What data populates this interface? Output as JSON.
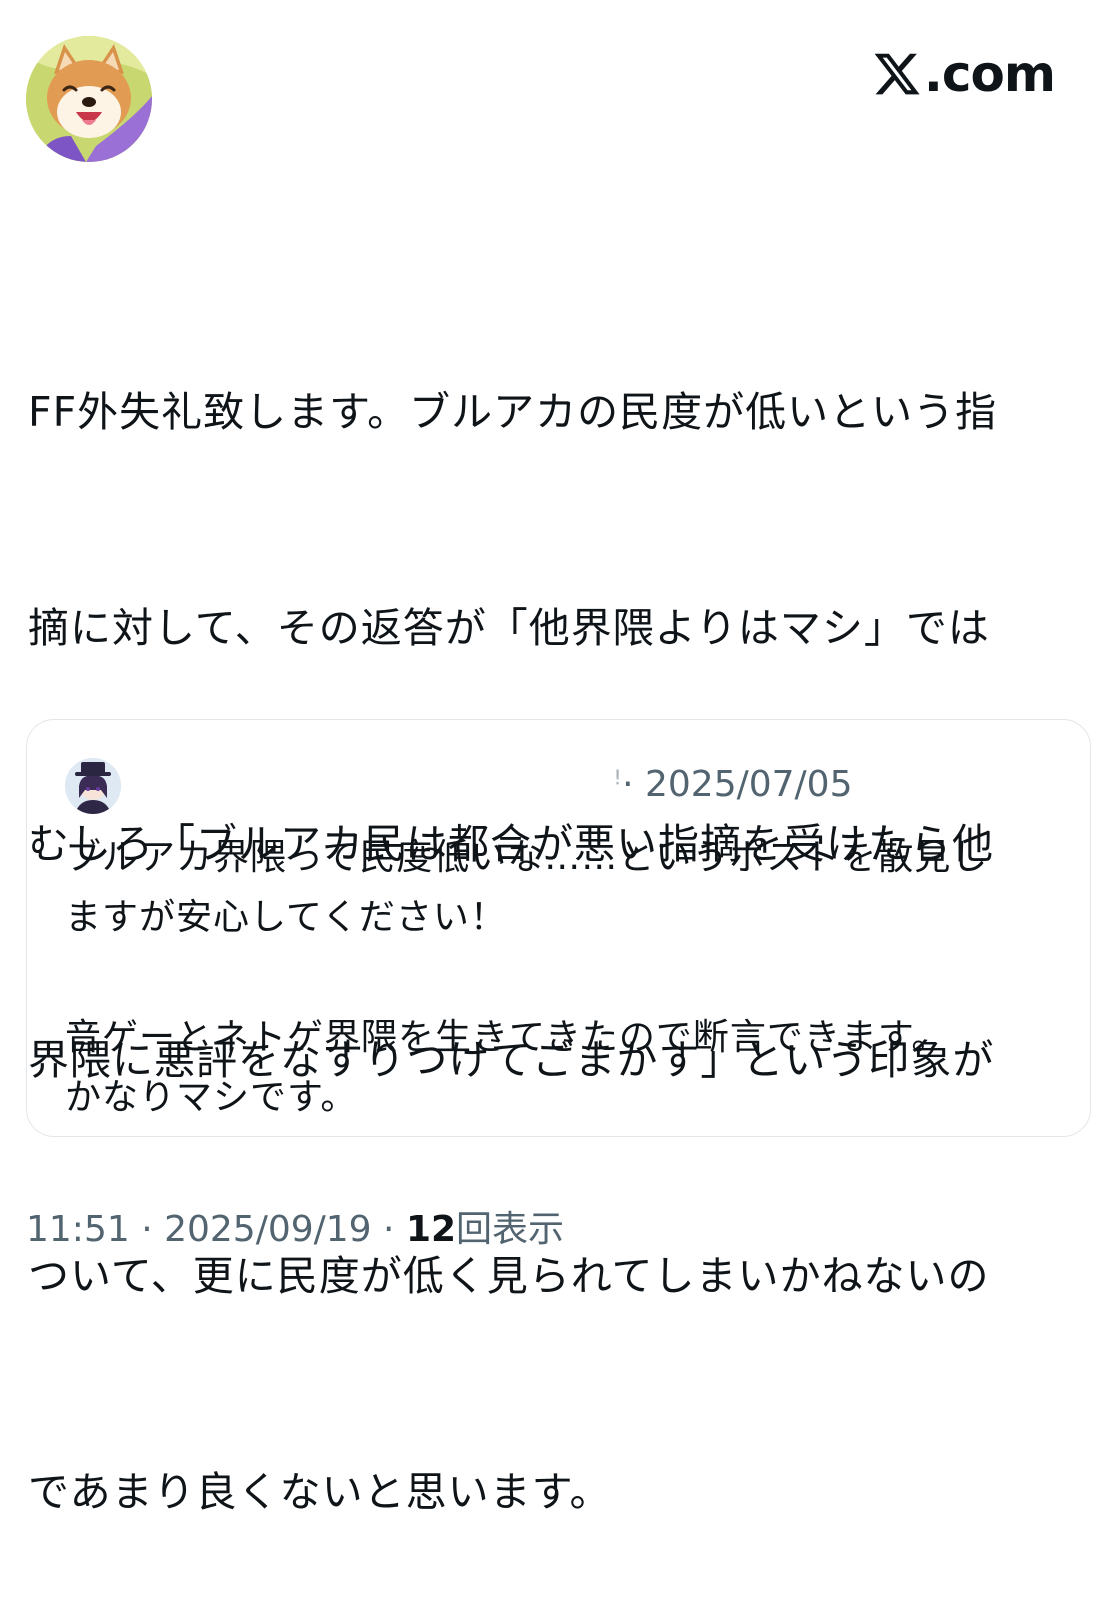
{
  "brand": {
    "logo_text": ".com",
    "icon": "x-logo-icon"
  },
  "post": {
    "avatar_icon": "shiba-dog-avatar-icon",
    "text_lines": [
      "FF外失礼致します。ブルアカの民度が低いという指",
      "摘に対して、その返答が「他界隈よりはマシ」では",
      "むしろ「ブルアカ民は都合が悪い指摘を受けたら他",
      "界隈に悪評をなすりつけてごまかす」という印象が",
      "ついて、更に民度が低く見られてしまいかねないの",
      "であまり良くないと思います。"
    ]
  },
  "quote": {
    "avatar_icon": "anime-character-avatar-icon",
    "meta_cut": "̶",
    "date": "· 2025/07/05",
    "text_lines": [
      "ブルアカ界隈って民度低いな……というポストを散見し",
      "ますが安心してください！"
    ],
    "text_lines_2": [
      "音ゲーとネトゲ界隈を生きてきたので断言できます。",
      "かなりマシです。"
    ]
  },
  "footer": {
    "time": "11:51",
    "sep1": " · ",
    "date": "2025/09/19",
    "sep2": " · ",
    "views_count": "12",
    "views_label": "回表示"
  },
  "colors": {
    "text": "#0f1419",
    "secondary": "#536471",
    "border": "#e1e6ea"
  }
}
